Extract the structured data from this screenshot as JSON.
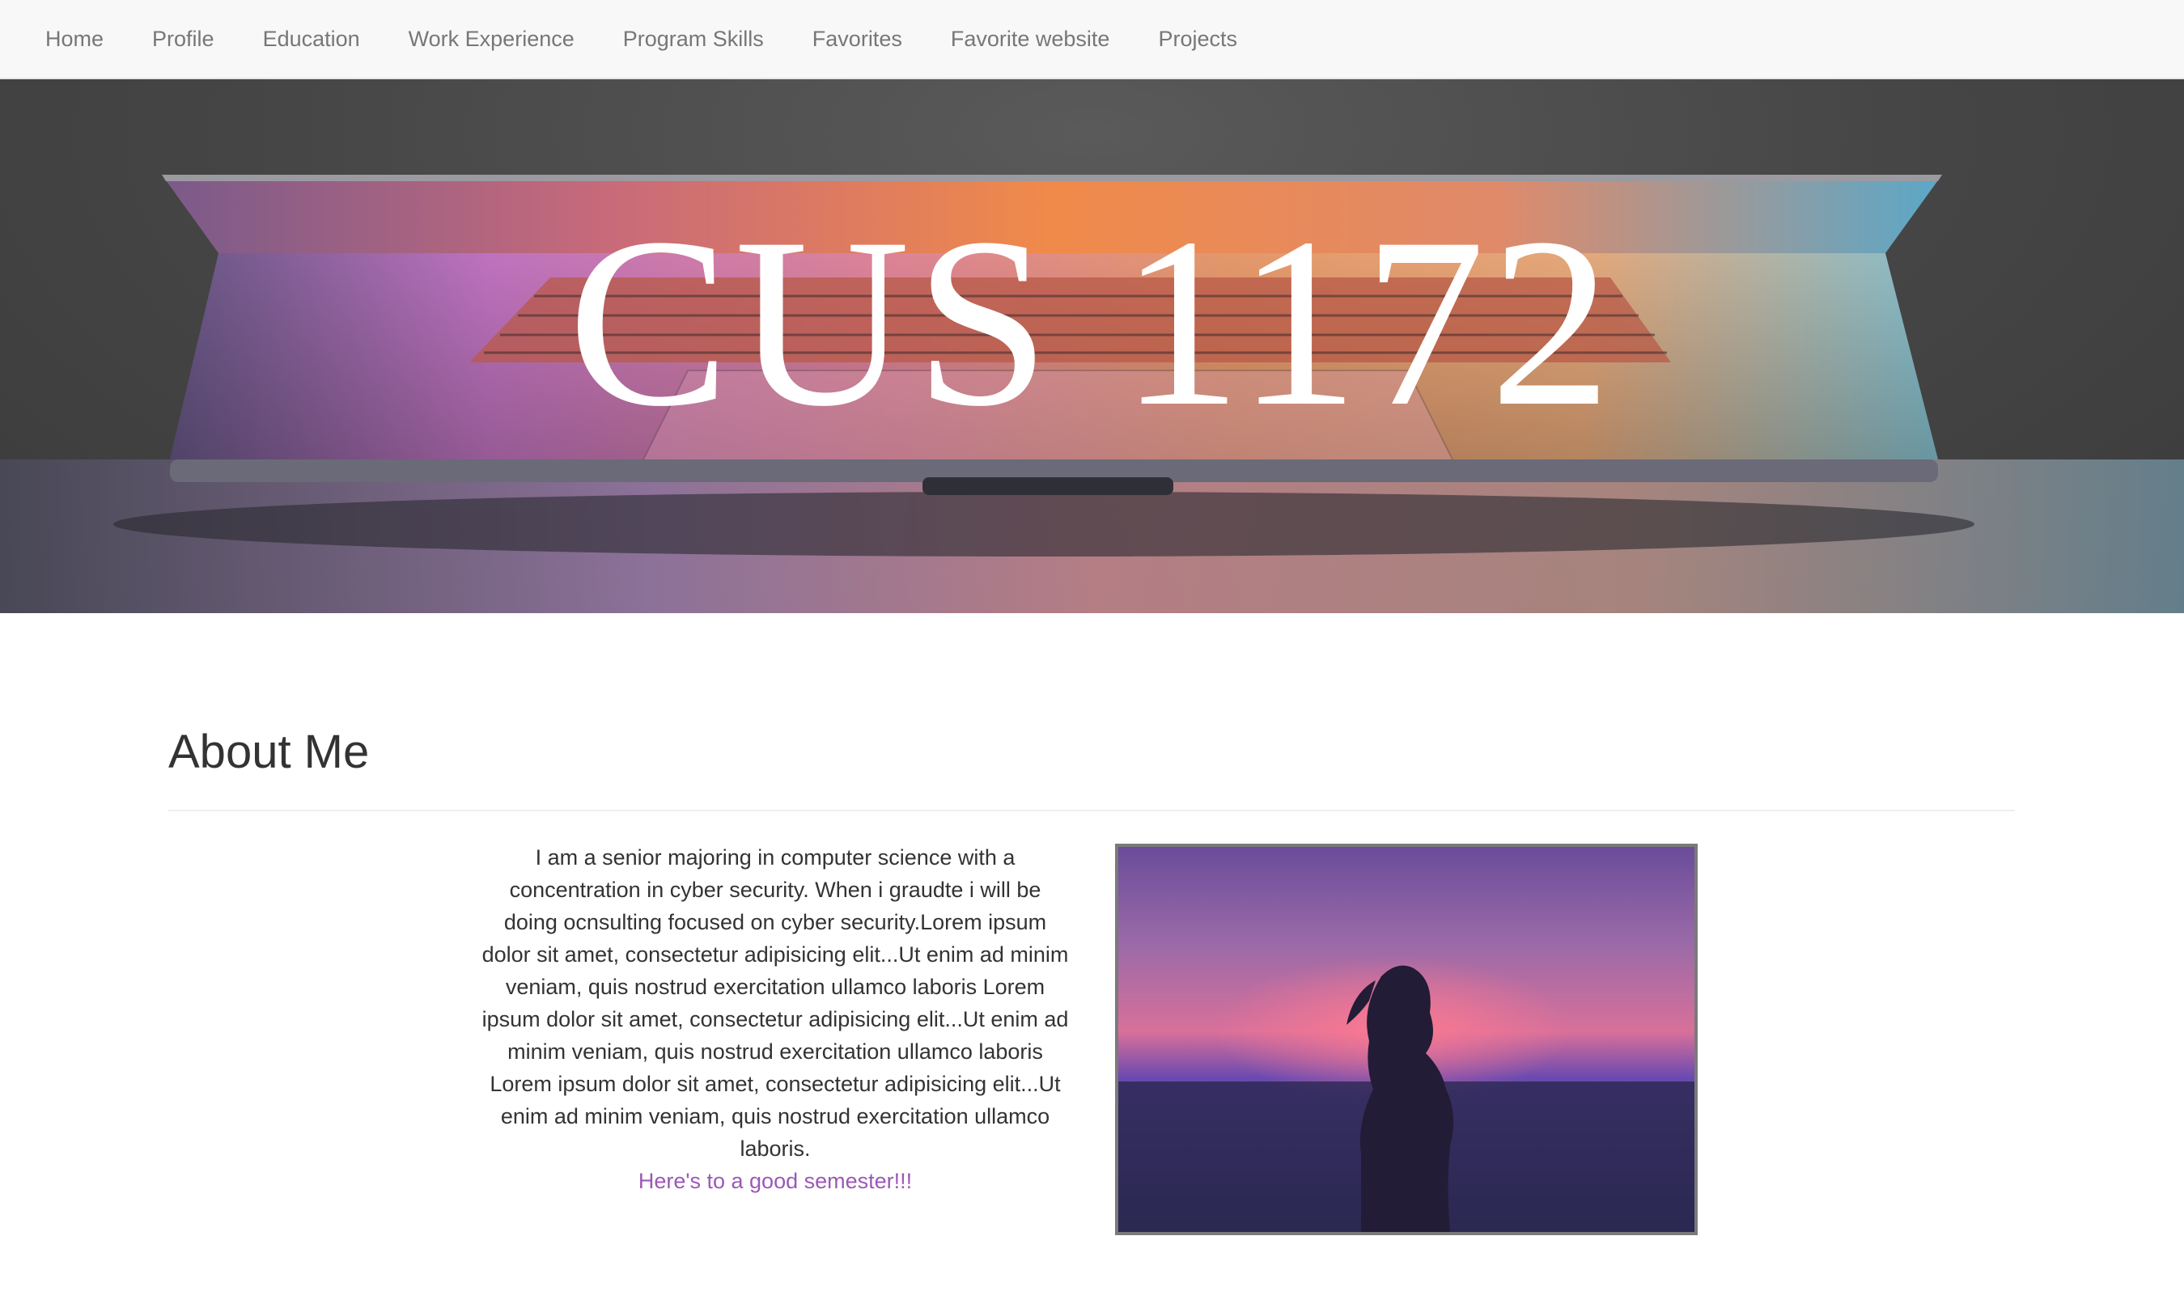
{
  "nav": {
    "items": [
      {
        "label": "Home"
      },
      {
        "label": "Profile"
      },
      {
        "label": "Education"
      },
      {
        "label": "Work Experience"
      },
      {
        "label": "Program Skills"
      },
      {
        "label": "Favorites"
      },
      {
        "label": "Favorite website"
      },
      {
        "label": "Projects"
      }
    ]
  },
  "hero": {
    "title": "CUS 1172",
    "image": "laptop-keyboard-photo"
  },
  "about": {
    "heading": "About Me",
    "paragraph": "I am a senior majoring in computer science with a concentration in cyber security. When i graudte i will be doing ocnsulting focused on cyber security.Lorem ipsum dolor sit amet, consectetur adipisicing elit...Ut enim ad minim veniam, quis nostrud exercitation ullamco laboris Lorem ipsum dolor sit amet, consectetur adipisicing elit...Ut enim ad minim veniam, quis nostrud exercitation ullamco laboris Lorem ipsum dolor sit amet, consectetur adipisicing elit...Ut enim ad minim veniam, quis nostrud exercitation ullamco laboris.",
    "link_text": "Here's to a good semester!!!",
    "photo": "woman-silhouette-sunset-photo"
  },
  "colors": {
    "nav_bg": "#f8f8f8",
    "nav_text": "#777777",
    "link": "#9b59b6",
    "photo_border": "#7a7a7a"
  }
}
